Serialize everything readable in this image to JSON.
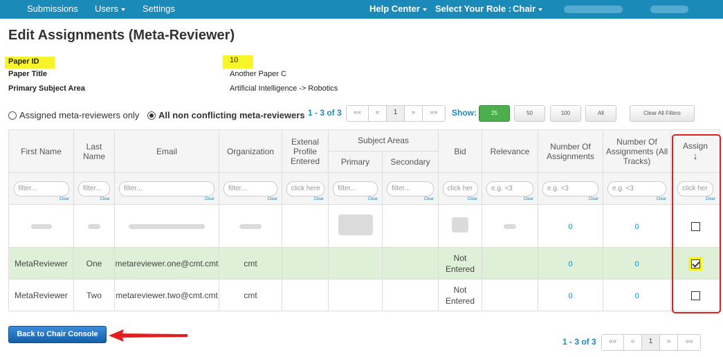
{
  "nav": {
    "submissions": "Submissions",
    "users": "Users",
    "settings": "Settings",
    "help_center": "Help Center",
    "select_role": "Select Your Role :",
    "role": "Chair"
  },
  "page": {
    "title": "Edit Assignments (Meta-Reviewer)",
    "paper_id_label": "Paper ID",
    "paper_id": "10",
    "paper_title_label": "Paper Title",
    "paper_title": "Another Paper C",
    "subject_area_label": "Primary Subject Area",
    "subject_area": "Artificial Intelligence -> Robotics"
  },
  "filters": {
    "assigned_only": "Assigned meta-reviewers only",
    "all_nonconflicting": "All non conflicting meta-reviewers"
  },
  "pager": {
    "info": "1 - 3 of 3",
    "first": "««",
    "prev": "«",
    "page": "1",
    "next": "»",
    "last": "»»",
    "show_label": "Show:",
    "sizes": [
      "25",
      "50",
      "100",
      "All"
    ],
    "clear_filters": "Clear All Filters"
  },
  "table": {
    "headers": {
      "first_name": "First Name",
      "last_name": "Last Name",
      "email": "Email",
      "organization": "Organization",
      "profile": "Extenal Profile Entered",
      "subject_areas": "Subject Areas",
      "primary": "Primary",
      "secondary": "Secondary",
      "bid": "Bid",
      "relevance": "Relevance",
      "num_assign": "Number Of Assignments",
      "num_assign_all": "Number Of Assignments (All Tracks)",
      "assign": "Assign",
      "sort_arrow": "↓"
    },
    "filter_placeholders": {
      "text": "filter...",
      "click": "click here",
      "click_short": "click her",
      "lt": "e.g. <3",
      "clear": "Clear"
    },
    "rows": [
      {
        "first": "",
        "last": "",
        "email": "",
        "org": "",
        "bid": "",
        "num": "0",
        "num_all": "0",
        "assigned": false
      },
      {
        "first": "MetaReviewer",
        "last": "One",
        "email": "metareviewer.one@cmt.cmt",
        "org": "cmt",
        "bid": "Not Entered",
        "num": "0",
        "num_all": "0",
        "assigned": true
      },
      {
        "first": "MetaReviewer",
        "last": "Two",
        "email": "metareviewer.two@cmt.cmt",
        "org": "cmt",
        "bid": "Not Entered",
        "num": "0",
        "num_all": "0",
        "assigned": false
      }
    ]
  },
  "back_button": "Back to Chair Console",
  "colors": {
    "nav_bg": "#1a8ab8",
    "highlight": "#f7f52a",
    "selected_row": "#dff0d8",
    "annotation_red": "#e02020"
  }
}
